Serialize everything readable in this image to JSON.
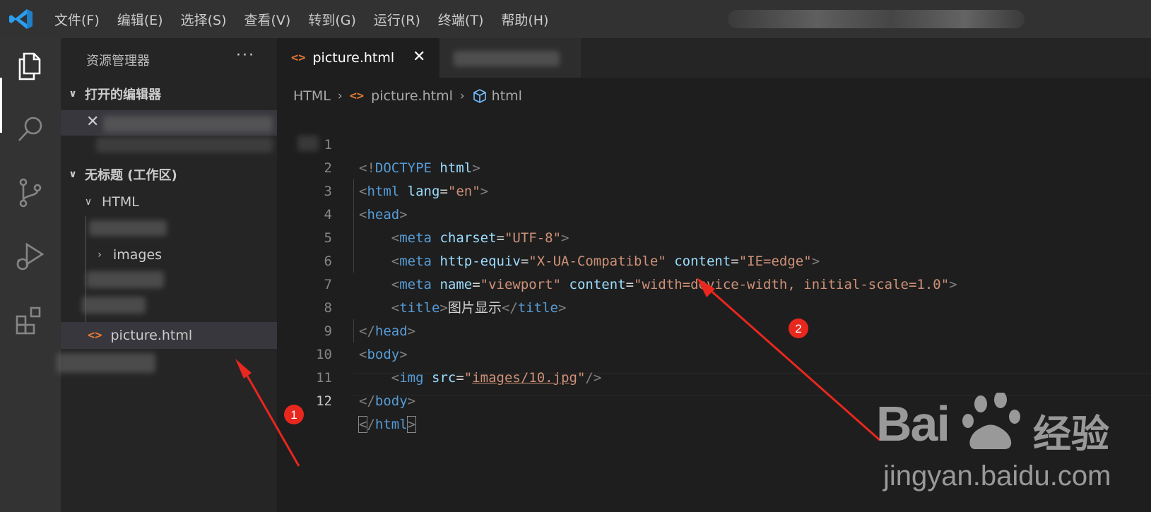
{
  "menu": [
    "文件(F)",
    "编辑(E)",
    "选择(S)",
    "查看(V)",
    "转到(G)",
    "运行(R)",
    "终端(T)",
    "帮助(H)"
  ],
  "sidebar": {
    "title": "资源管理器",
    "more": "···",
    "open_editors_header": "打开的编辑器",
    "workspace_header": "无标题 (工作区)",
    "folder_html": "HTML",
    "folder_images": "images",
    "file_selected": "picture.html"
  },
  "tab": {
    "label": "picture.html",
    "close": "✕"
  },
  "breadcrumb": [
    "HTML",
    "picture.html",
    "html"
  ],
  "code": {
    "lines": [
      {
        "n": "1"
      },
      {
        "n": "2"
      },
      {
        "n": "3"
      },
      {
        "n": "4"
      },
      {
        "n": "5"
      },
      {
        "n": "6"
      },
      {
        "n": "7"
      },
      {
        "n": "8"
      },
      {
        "n": "9"
      },
      {
        "n": "10"
      },
      {
        "n": "11"
      },
      {
        "n": "12"
      }
    ]
  },
  "annotations": [
    "1",
    "2"
  ],
  "watermark": {
    "brand": "Bai",
    "brand_cn": "经验",
    "url": "jingyan.baidu.com"
  },
  "colors": {
    "accent": "#007acc",
    "arrow": "#e8271e",
    "tag": "#569cd6",
    "attr": "#9cdcfe",
    "string": "#ce9178"
  }
}
